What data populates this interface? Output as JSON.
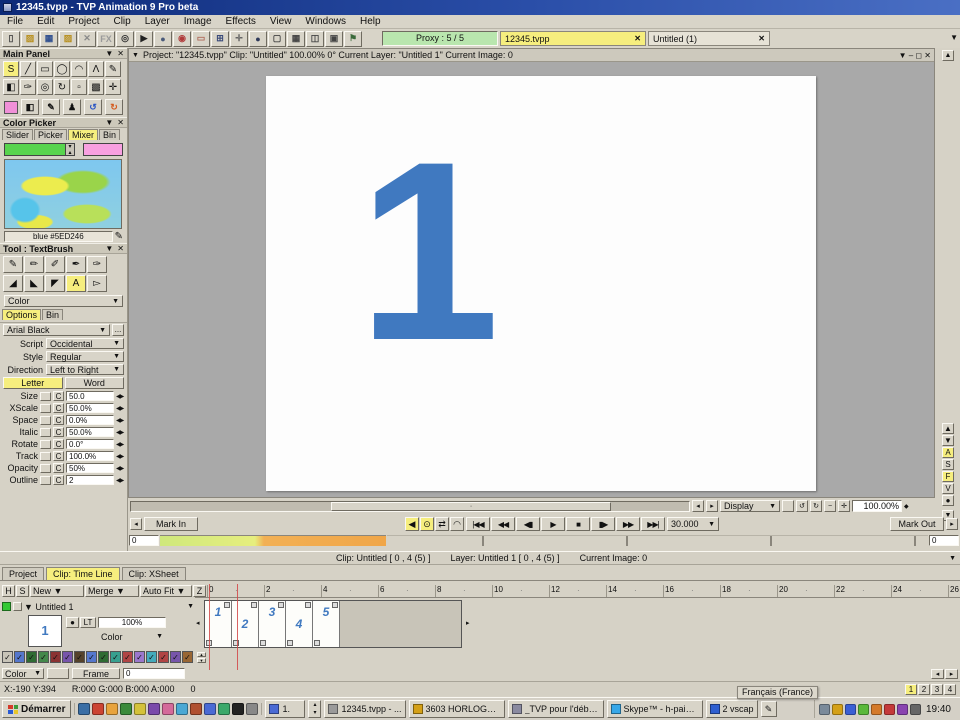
{
  "titlebar": {
    "title": "12345.tvpp - TVP Animation 9 Pro beta"
  },
  "menubar": {
    "items": [
      "File",
      "Edit",
      "Project",
      "Clip",
      "Layer",
      "Image",
      "Effects",
      "View",
      "Windows",
      "Help"
    ]
  },
  "toolbar": {
    "buttons": [
      {
        "name": "new-file-icon",
        "glyph": "▯",
        "color": "#444444"
      },
      {
        "name": "open-folder-icon",
        "glyph": "▨",
        "color": "#b8901f"
      },
      {
        "name": "save-icon",
        "glyph": "▦",
        "color": "#2f4f8f"
      },
      {
        "name": "library-folder-icon",
        "glyph": "▨",
        "color": "#b8901f"
      },
      {
        "name": "brushes-off-icon",
        "glyph": "✕",
        "color": "#8a8a8a"
      },
      {
        "name": "fx-icon",
        "glyph": "FX",
        "color": "#9a9a9a"
      },
      {
        "name": "magnifier-icon",
        "glyph": "◎",
        "color": "#333333"
      },
      {
        "name": "play-icon",
        "glyph": "▶",
        "color": "#222222"
      },
      {
        "name": "sphere-icon",
        "glyph": "●",
        "color": "#4a5a7a"
      },
      {
        "name": "color-wheel-icon",
        "glyph": "◉",
        "color": "#b03a3a"
      },
      {
        "name": "frame-icon",
        "glyph": "▭",
        "color": "#b06a5a"
      },
      {
        "name": "grid-plus-icon",
        "glyph": "⊞",
        "color": "#3a4a7a"
      },
      {
        "name": "crosshair-icon",
        "glyph": "✛",
        "color": "#666666"
      },
      {
        "name": "dark-sphere-icon",
        "glyph": "●",
        "color": "#2f3a5a"
      },
      {
        "name": "window-icon",
        "glyph": "▢",
        "color": "#444444"
      },
      {
        "name": "table-icon",
        "glyph": "▦",
        "color": "#444444"
      },
      {
        "name": "split-view-icon",
        "glyph": "◫",
        "color": "#444444"
      },
      {
        "name": "monitor-icon",
        "glyph": "▣",
        "color": "#444444"
      },
      {
        "name": "flag-icon",
        "glyph": "⚑",
        "color": "#3a6a3a"
      }
    ],
    "proxy_label": "Proxy : 5 / 5",
    "tab1": "12345.tvpp",
    "tab2": "Untitled (1)",
    "close_glyph": "✕",
    "dropdown_glyph": "▼"
  },
  "main_panel": {
    "title": "Main Panel",
    "tools_row1": [
      {
        "name": "freehand-tool-icon",
        "glyph": "S",
        "active": true
      },
      {
        "name": "line-tool-icon",
        "glyph": "╱"
      },
      {
        "name": "rect-tool-icon",
        "glyph": "▭"
      },
      {
        "name": "ellipse-tool-icon",
        "glyph": "◯"
      },
      {
        "name": "arc-tool-icon",
        "glyph": "◠"
      },
      {
        "name": "polyline-tool-icon",
        "glyph": "Λ"
      },
      {
        "name": "eraser-tool-icon",
        "glyph": "✎"
      }
    ],
    "tools_row2": [
      {
        "name": "fill-tool-icon",
        "glyph": "◧"
      },
      {
        "name": "airbrush-tool-icon",
        "glyph": "✑"
      },
      {
        "name": "zoom-tool-icon",
        "glyph": "◎"
      },
      {
        "name": "rotate-tool-icon",
        "glyph": "↻"
      },
      {
        "name": "select-tool-icon",
        "glyph": "▫"
      },
      {
        "name": "warp-tool-icon",
        "glyph": "▩"
      },
      {
        "name": "pan-tool-icon",
        "glyph": "✛"
      }
    ],
    "swatch_color": "#f090d8",
    "bw_glyph": "◧",
    "brush_glyph": "✎",
    "figure_glyph": "♟",
    "undo_glyph": "↺",
    "redo_glyph": "↻"
  },
  "color_picker": {
    "title": "Color Picker",
    "tabs": {
      "slider": "Slider",
      "picker": "Picker",
      "mixer": "Mixer",
      "bin": "Bin"
    },
    "primary_color": "#58d44e",
    "secondary_color": "#f8a0e0",
    "color_label": "blue #5ED246",
    "pen_glyph": "✎"
  },
  "text_tool": {
    "title": "Tool : TextBrush",
    "brushes_row1": [
      {
        "name": "pencil-brush-icon",
        "glyph": "✎"
      },
      {
        "name": "pen-brush-icon",
        "glyph": "✏"
      },
      {
        "name": "marker-brush-icon",
        "glyph": "✐"
      },
      {
        "name": "red-pen-brush-icon",
        "glyph": "✒"
      },
      {
        "name": "quill-brush-icon",
        "glyph": "✑"
      }
    ],
    "brushes_row2": [
      {
        "name": "dark-brush-icon",
        "glyph": "◢"
      },
      {
        "name": "flat-brush-icon",
        "glyph": "◣"
      },
      {
        "name": "angle-brush-icon",
        "glyph": "◤"
      },
      {
        "name": "text-brush-icon",
        "glyph": "A",
        "active": true
      },
      {
        "name": "cursor-box-icon",
        "glyph": "▻"
      }
    ],
    "color_dd": "Color",
    "tabs": {
      "options": "Options",
      "bin": "Bin"
    },
    "font_name": "Arial Black",
    "font_more": "...",
    "rows": [
      {
        "label": "Script",
        "value": "Occidental"
      },
      {
        "label": "Style",
        "value": "Regular"
      },
      {
        "label": "Direction",
        "value": "Left to Right"
      }
    ],
    "modes": {
      "letter": "Letter",
      "word": "Word"
    },
    "params": [
      {
        "label": "Size",
        "c": "C",
        "value": "50.0"
      },
      {
        "label": "XScale",
        "c": "C",
        "value": "50.0%"
      },
      {
        "label": "Space",
        "c": "C",
        "value": "0.0%"
      },
      {
        "label": "Italic",
        "c": "C",
        "value": "50.0%"
      },
      {
        "label": "Rotate",
        "c": "C",
        "value": "0.0°"
      },
      {
        "label": "Track",
        "c": "C",
        "value": "100.0%"
      },
      {
        "label": "Opacity",
        "c": "C",
        "value": "50%"
      },
      {
        "label": "Outline",
        "c": "C",
        "value": "2"
      }
    ]
  },
  "canvas": {
    "info": "Project: \"12345.tvpp\"   Clip: \"Untitled\"   100.00%   0°   Current Layer: \"Untitled 1\"   Current Image: 0",
    "collapse_glyph": "▼",
    "win_buttons": "▼  –  ◻  ✕",
    "digit": "1",
    "digit_color": "#4079c0"
  },
  "right_strip": {
    "up_glyph": "▲",
    "down_glyph": "▼",
    "letters": [
      {
        "glyph": "▲"
      },
      {
        "glyph": "▼"
      },
      {
        "glyph": "A",
        "active": true
      },
      {
        "glyph": "S"
      },
      {
        "glyph": "F",
        "active": true
      },
      {
        "glyph": "V"
      },
      {
        "glyph": "●"
      }
    ]
  },
  "viewbar": {
    "left_arrow": "◂",
    "right_arrow": "▸",
    "display_label": "Display",
    "undo_view": "↺",
    "redo_view": "↻",
    "minus": "−",
    "plus": "✛",
    "zoom_value": "100.00%",
    "spin": "◆"
  },
  "transport": {
    "mark_in": "Mark In",
    "mark_out": "Mark Out",
    "toggles": [
      {
        "name": "play-backward-toggle",
        "glyph": "◀",
        "active": true
      },
      {
        "name": "loop-toggle",
        "glyph": "⊙",
        "active": true
      },
      {
        "name": "flip-toggle",
        "glyph": "⇄",
        "active": false
      },
      {
        "name": "lighttable-toggle",
        "glyph": "◠",
        "active": false
      }
    ],
    "buttons": [
      {
        "name": "first-frame-button",
        "glyph": "|◀◀"
      },
      {
        "name": "prev-key-button",
        "glyph": "◀◀"
      },
      {
        "name": "prev-frame-button",
        "glyph": "◀▮"
      },
      {
        "name": "play-button",
        "glyph": "▶"
      },
      {
        "name": "stop-button",
        "glyph": "■"
      },
      {
        "name": "next-frame-button",
        "glyph": "▮▶"
      },
      {
        "name": "next-key-button",
        "glyph": "▶▶"
      },
      {
        "name": "last-frame-button",
        "glyph": "▶▶|"
      }
    ],
    "fps": "30.000"
  },
  "navrow": {
    "left_value": "0",
    "right_value": "0"
  },
  "statusrow": {
    "clip": "Clip: Untitled [ 0 , 4  (5) ]",
    "layer": "Layer: Untitled 1 [ 0 , 4  (5) ]",
    "image": "Current Image: 0",
    "dropdown_glyph": "▼"
  },
  "bottom_tabs": {
    "project": "Project",
    "timeline": "Clip: Time Line",
    "xsheet": "Clip: XSheet"
  },
  "timeline": {
    "header": {
      "h": "H",
      "s": "S",
      "new": "New",
      "merge": "Merge",
      "autofit": "Auto Fit",
      "z": "Z"
    },
    "ruler": [
      "0",
      "2",
      "4",
      "6",
      "8",
      "10",
      "12",
      "14",
      "16",
      "18",
      "20",
      "22",
      "24",
      "26"
    ],
    "layer_name": "Untitled 1",
    "thumb_label": "1",
    "lock_glyph": "●",
    "lt_label": "LT",
    "opacity": "100%",
    "color_dd": "Color",
    "frames": [
      "1",
      "2",
      "3",
      "4",
      "5"
    ],
    "swatches": [
      "#5577cc",
      "#2f6b33",
      "#44884a",
      "#8a3333",
      "#7755aa",
      "#55422a",
      "#5577cc",
      "#2f6b33",
      "#37a08f",
      "#b04444",
      "#9a77cc",
      "#44aabb",
      "#b04444",
      "#7755aa",
      "#996633"
    ],
    "bottom": {
      "color": "Color",
      "frame": "Frame",
      "value": "0"
    },
    "status": {
      "xy": "X:-190 Y:394",
      "rgba": "R:000 G:000 B:000 A:000",
      "extra": "0"
    },
    "pages": [
      "1",
      "2",
      "3",
      "4"
    ]
  },
  "taskbar": {
    "start_label": "Démarrer",
    "flag_colors": [
      "#d43a2a",
      "#3a9a3a",
      "#2a5ad4",
      "#e8c62a"
    ],
    "quicklaunch": [
      "#3a6ea5",
      "#cc4433",
      "#e8a33d",
      "#3a8a3a",
      "#d4c23a",
      "#7a4aaa",
      "#d46a9a",
      "#4aa8d4",
      "#b05030",
      "#4a6ad4",
      "#3aa86a",
      "#222222",
      "#888888"
    ],
    "small_task": {
      "label": "1.",
      "color": "#4a6ad4"
    },
    "tasks": [
      {
        "label": "12345.tvpp - ...",
        "color": "#9a9a9a"
      },
      {
        "label": "3603 HORLOGE...",
        "color": "#d4a017"
      },
      {
        "label": "_TVP pour l'déba...",
        "color": "#8a8aa0"
      },
      {
        "label": "Skype™ - h-paint...",
        "color": "#38a8e8"
      },
      {
        "label": "2 vscap",
        "color": "#2f5fd0"
      }
    ],
    "language_glyph": "✎",
    "language_tooltip": "Français (France)",
    "tray": [
      "#7a8a9a",
      "#d4a017",
      "#3a5fd4",
      "#5ab83a",
      "#d47a2a",
      "#c43a3a",
      "#8a44b0",
      "#666666"
    ],
    "clock": "19:40"
  }
}
